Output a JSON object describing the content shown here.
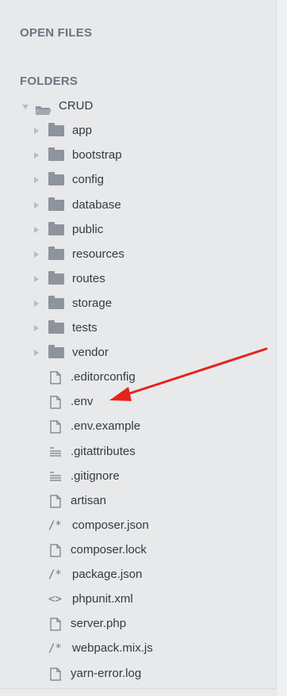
{
  "sidebar": {
    "open_files_title": "OPEN FILES",
    "folders_title": "FOLDERS",
    "root": {
      "label": "CRUD",
      "icon": "folder-open-icon"
    },
    "folders": [
      {
        "label": "app"
      },
      {
        "label": "bootstrap"
      },
      {
        "label": "config"
      },
      {
        "label": "database"
      },
      {
        "label": "public"
      },
      {
        "label": "resources"
      },
      {
        "label": "routes"
      },
      {
        "label": "storage"
      },
      {
        "label": "tests"
      },
      {
        "label": "vendor"
      }
    ],
    "files": [
      {
        "label": ".editorconfig",
        "icon": "file-icon"
      },
      {
        "label": ".env",
        "icon": "file-icon"
      },
      {
        "label": ".env.example",
        "icon": "file-icon"
      },
      {
        "label": ".gitattributes",
        "icon": "text-lines-icon"
      },
      {
        "label": ".gitignore",
        "icon": "text-lines-icon"
      },
      {
        "label": "artisan",
        "icon": "file-icon"
      },
      {
        "label": "composer.json",
        "icon": "comment-icon"
      },
      {
        "label": "composer.lock",
        "icon": "file-icon"
      },
      {
        "label": "package.json",
        "icon": "comment-icon"
      },
      {
        "label": "phpunit.xml",
        "icon": "code-icon"
      },
      {
        "label": "server.php",
        "icon": "file-icon"
      },
      {
        "label": "webpack.mix.js",
        "icon": "comment-icon"
      },
      {
        "label": "yarn-error.log",
        "icon": "file-icon"
      }
    ]
  },
  "annotation": {
    "color": "#e3241b",
    "target": ".env"
  },
  "colors": {
    "sidebar_bg": "#e8e9ea",
    "text": "#333a44",
    "icon": "#8e949c"
  }
}
